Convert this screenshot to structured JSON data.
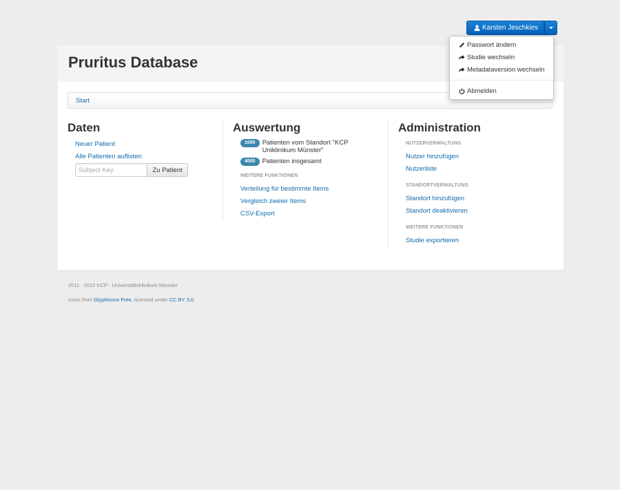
{
  "user_menu": {
    "user_name": "Karsten Jeschkies",
    "items": [
      {
        "label": "Passwort ändern",
        "icon": "pencil-icon"
      },
      {
        "label": "Studie wechseln",
        "icon": "share-arrow-icon"
      },
      {
        "label": "Metadataversion wechseln",
        "icon": "share-arrow-icon"
      }
    ],
    "logout_label": "Abmelden",
    "logout_icon": "power-icon"
  },
  "header": {
    "title": "Pruritus Database"
  },
  "breadcrumb": {
    "start": "Start"
  },
  "daten": {
    "title": "Daten",
    "new_patient": "Neuer Patient",
    "list_patients": "Alle Patienten auflisten",
    "subject_placeholder": "Subject Key",
    "go_button": "Zu Patient"
  },
  "auswertung": {
    "title": "Auswertung",
    "stats": [
      {
        "count": "1000",
        "text": "Patienten vom Standort \"KCP Uniklinikum Münster\""
      },
      {
        "count": "4000",
        "text": "Patienten insgesamt"
      }
    ],
    "section_label": "WEITERE FUNKTIONEN",
    "links": [
      "Verteilung für bestimmte Items",
      "Vergleich zweier Items",
      "CSV-Export"
    ]
  },
  "administration": {
    "title": "Administration",
    "user_section": "NUTZERVERWALTUNG",
    "user_links": [
      "Nutzer hinzufügen",
      "Nutzerliste"
    ],
    "site_section": "STANDORTVERWALTUNG",
    "site_links": [
      "Standort hinzufügen",
      "Standort deaktivieren"
    ],
    "more_section": "WEITERE FUNKTIONEN",
    "more_links": [
      "Studie exportieren"
    ]
  },
  "footer": {
    "copyright": "2011 - 2012 KCP - Universitätsklinikum Münster",
    "icons_prefix": "Icons from ",
    "glyphicons_link": "Glyphicons Free",
    "licensed_text": ", licensed under ",
    "license_link": "CC BY 3.0",
    "period": "."
  }
}
